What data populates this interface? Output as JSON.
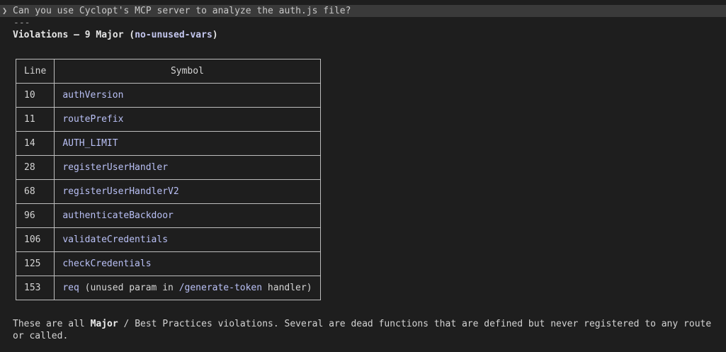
{
  "prompt": {
    "arrow": "❯",
    "text": "Can you use Cyclopt's MCP server to analyze the auth.js file?"
  },
  "divider": "---",
  "heading": {
    "title": "Violations — 9 Major",
    "rule": "no-unused-vars"
  },
  "table": {
    "headers": {
      "line": "Line",
      "symbol": "Symbol"
    },
    "rows": [
      {
        "line": "10",
        "symbol": "authVersion"
      },
      {
        "line": "11",
        "symbol": "routePrefix"
      },
      {
        "line": "14",
        "symbol": "AUTH_LIMIT"
      },
      {
        "line": "28",
        "symbol": "registerUserHandler"
      },
      {
        "line": "68",
        "symbol": "registerUserHandlerV2"
      },
      {
        "line": "96",
        "symbol": "authenticateBackdoor"
      },
      {
        "line": "106",
        "symbol": "validateCredentials"
      },
      {
        "line": "125",
        "symbol": "checkCredentials"
      },
      {
        "line": "153",
        "symbol": "req",
        "note_before": " (unused param in ",
        "route": "/generate-token",
        "note_after": " handler)"
      }
    ]
  },
  "footer": {
    "prefix": "These are all ",
    "bold": "Major",
    "suffix": " / Best Practices violations. Several are dead functions that are defined but never registered to any route or called."
  }
}
